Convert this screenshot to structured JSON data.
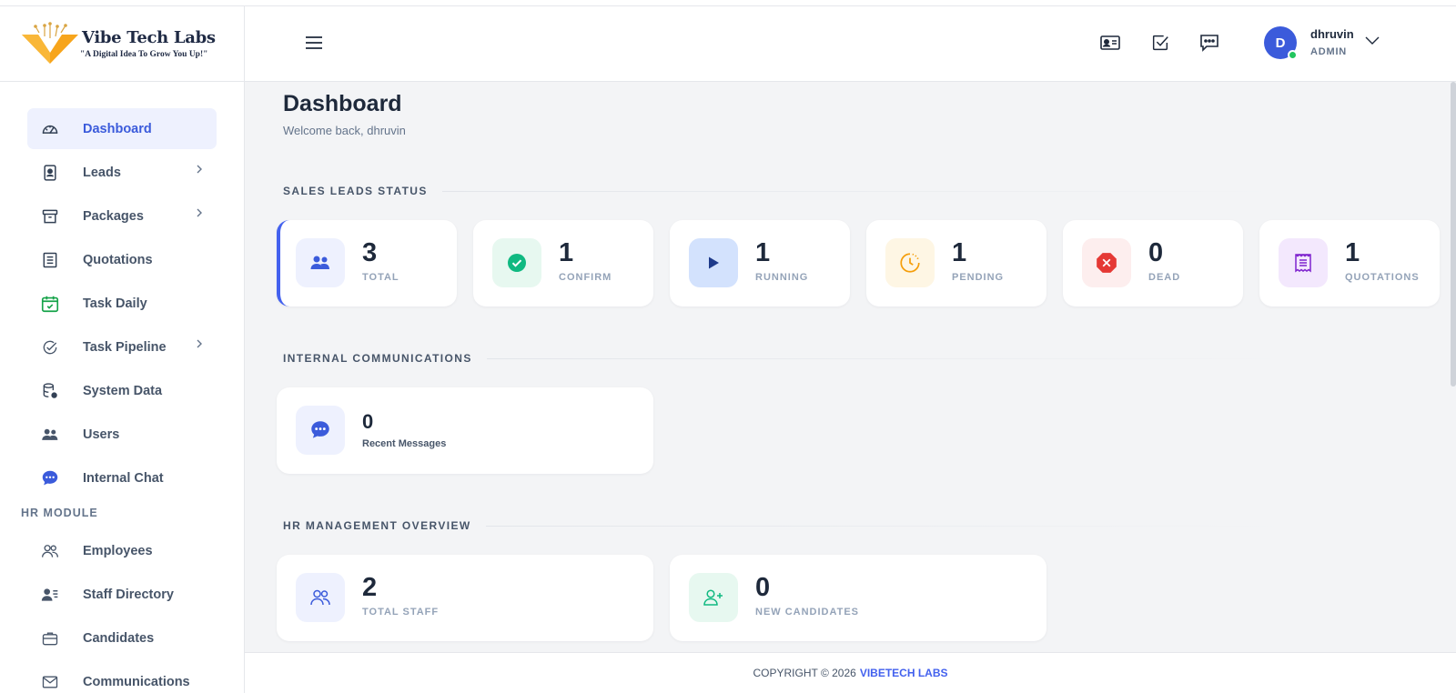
{
  "brand": {
    "name": "Vibe Tech Labs",
    "tagline": "\"A Digital Idea To Grow You Up!\""
  },
  "sidebar": {
    "items": [
      {
        "label": "Dashboard",
        "icon": "gauge-icon",
        "active": true
      },
      {
        "label": "Leads",
        "icon": "id-badge-icon",
        "chevron": true
      },
      {
        "label": "Packages",
        "icon": "archive-box-icon",
        "chevron": true
      },
      {
        "label": "Quotations",
        "icon": "document-list-icon"
      },
      {
        "label": "Task Daily",
        "icon": "calendar-check-icon"
      },
      {
        "label": "Task Pipeline",
        "icon": "circle-check-icon",
        "chevron": true
      },
      {
        "label": "System Data",
        "icon": "database-gear-icon"
      },
      {
        "label": "Users",
        "icon": "users-icon"
      },
      {
        "label": "Internal Chat",
        "icon": "chat-bubble-icon"
      }
    ],
    "hr_section_label": "HR MODULE",
    "hr_items": [
      {
        "label": "Employees",
        "icon": "people-outline-icon"
      },
      {
        "label": "Staff Directory",
        "icon": "user-list-icon"
      },
      {
        "label": "Candidates",
        "icon": "briefcase-icon"
      },
      {
        "label": "Communications",
        "icon": "envelope-icon"
      }
    ]
  },
  "header": {
    "user": {
      "initial": "D",
      "name": "dhruvin",
      "role": "ADMIN"
    }
  },
  "page": {
    "title": "Dashboard",
    "subtitle": "Welcome back, dhruvin"
  },
  "sections": {
    "sales": "SALES LEADS STATUS",
    "internal": "INTERNAL COMMUNICATIONS",
    "hr": "HR MANAGEMENT OVERVIEW"
  },
  "sales_cards": [
    {
      "value": "3",
      "label": "TOTAL",
      "icon": "users-icon"
    },
    {
      "value": "1",
      "label": "CONFIRM",
      "icon": "check-circle-icon"
    },
    {
      "value": "1",
      "label": "RUNNING",
      "icon": "play-icon"
    },
    {
      "value": "1",
      "label": "PENDING",
      "icon": "clock-icon"
    },
    {
      "value": "0",
      "label": "DEAD",
      "icon": "x-octagon-icon"
    },
    {
      "value": "1",
      "label": "QUOTATIONS",
      "icon": "receipt-icon"
    }
  ],
  "internal_cards": [
    {
      "value": "0",
      "label": "Recent Messages",
      "icon": "chat-bubble-icon"
    }
  ],
  "hr_cards": [
    {
      "value": "2",
      "label": "TOTAL STAFF",
      "icon": "people-outline-icon"
    },
    {
      "value": "0",
      "label": "NEW CANDIDATES",
      "icon": "user-plus-icon"
    }
  ],
  "footer": {
    "text": "COPYRIGHT © 2026",
    "brand": "VIBETECH LABS"
  },
  "colors": {
    "accent": "#3b5bdb",
    "success": "#10b981",
    "warning": "#f59e0b",
    "danger": "#ef4444",
    "purple": "#7e22ce",
    "online": "#22c55e"
  }
}
